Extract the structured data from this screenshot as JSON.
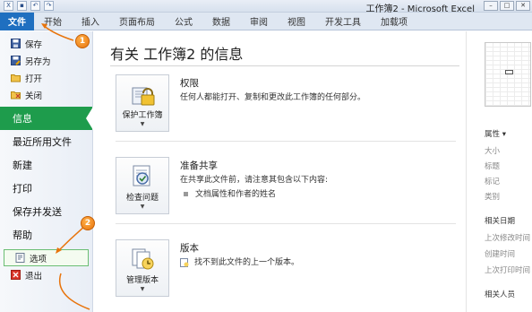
{
  "window": {
    "title": "工作簿2 - Microsoft Excel"
  },
  "ribbon": {
    "file_tab": "文件",
    "tabs": [
      "开始",
      "插入",
      "页面布局",
      "公式",
      "数据",
      "审阅",
      "视图",
      "开发工具",
      "加载项"
    ]
  },
  "nav": {
    "top_items": [
      {
        "label": "保存",
        "icon": "save-icon"
      },
      {
        "label": "另存为",
        "icon": "save-as-icon"
      },
      {
        "label": "打开",
        "icon": "open-folder-icon"
      },
      {
        "label": "关闭",
        "icon": "close-file-icon"
      }
    ],
    "info": "信息",
    "recent": "最近所用文件",
    "new": "新建",
    "print": "打印",
    "save_send": "保存并发送",
    "help": "帮助",
    "options": "选项",
    "exit": "退出"
  },
  "main": {
    "heading": "有关 工作簿2 的信息",
    "permissions": {
      "button_label": "保护工作簿",
      "title": "权限",
      "desc": "任何人都能打开、复制和更改此工作簿的任何部分。"
    },
    "prepare": {
      "button_label": "检查问题",
      "title": "准备共享",
      "desc": "在共享此文件前，请注意其包含以下内容:",
      "bullet": "文档属性和作者的姓名"
    },
    "versions": {
      "button_label": "管理版本",
      "title": "版本",
      "desc": "找不到此文件的上一个版本。"
    }
  },
  "right_panel": {
    "properties": "属性 ▾",
    "size": "大小",
    "title": "标题",
    "tags": "标记",
    "category": "类别",
    "related_dates": "相关日期",
    "last_modified": "上次修改时间",
    "created": "创建时间",
    "last_printed": "上次打印时间",
    "related_people": "相关人员"
  },
  "callouts": {
    "one": "1",
    "two": "2"
  },
  "colors": {
    "file_tab": "#1f6fc0",
    "active_nav": "#1e9c4c",
    "callout": "#e8740c"
  }
}
